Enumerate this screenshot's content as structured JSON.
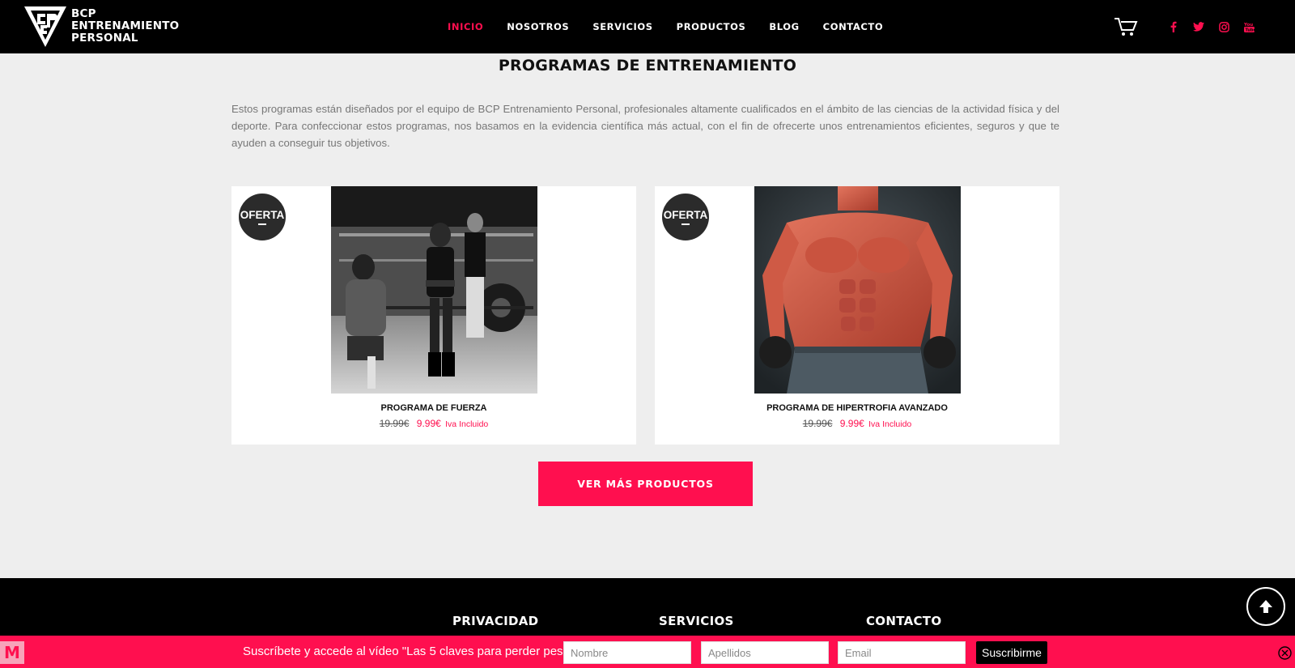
{
  "brand": {
    "line1": "BCP",
    "line2": "ENTRENAMIENTO",
    "line3": "PERSONAL"
  },
  "nav": {
    "items": [
      {
        "label": "INICIO",
        "active": true
      },
      {
        "label": "NOSOTROS",
        "active": false
      },
      {
        "label": "SERVICIOS",
        "active": false
      },
      {
        "label": "PRODUCTOS",
        "active": false
      },
      {
        "label": "BLOG",
        "active": false
      },
      {
        "label": "CONTACTO",
        "active": false
      }
    ]
  },
  "header_icons": [
    "cart-icon",
    "facebook-icon",
    "twitter-icon",
    "instagram-icon",
    "youtube-icon"
  ],
  "section": {
    "title": "PROGRAMAS DE ENTRENAMIENTO",
    "intro": "Estos programas están diseñados por el equipo de BCP Entrenamiento Personal, profesionales altamente cualificados en el ámbito de las ciencias de la actividad física y del deporte. Para confeccionar estos programas, nos basamos en la evidencia científica más actual, con el fin de ofrecerte unos entrenamientos eficientes, seguros y que te ayuden a conseguir tus objetivos."
  },
  "products": [
    {
      "badge": "OFERTA",
      "title": "PROGRAMA DE FUERZA",
      "old_price": "19.99€",
      "new_price": "9.99€",
      "tax": "Iva Incluido"
    },
    {
      "badge": "OFERTA",
      "title": "PROGRAMA DE HIPERTROFIA AVANZADO",
      "old_price": "19.99€",
      "new_price": "9.99€",
      "tax": "Iva Incluido"
    }
  ],
  "more_button": "VER MÁS PRODUCTOS",
  "footer": {
    "col1": "PRIVACIDAD",
    "col2": "SERVICIOS",
    "col3": "CONTACTO"
  },
  "subscribe": {
    "logo": "M",
    "text": "Suscríbete y accede al vídeo \"Las 5 claves para perder peso\"",
    "name_placeholder": "Nombre",
    "surname_placeholder": "Apellidos",
    "email_placeholder": "Email",
    "button": "Suscribirme"
  },
  "colors": {
    "accent": "#ff0f4f",
    "header_bg": "#000000",
    "page_bg": "#eeeeee",
    "badge_bg": "#2b2b2b"
  }
}
